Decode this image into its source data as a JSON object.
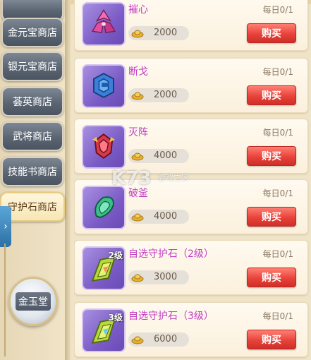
{
  "sidebar": {
    "tabs": [
      {
        "label": "金元宝商店"
      },
      {
        "label": "银元宝商店"
      },
      {
        "label": "荟英商店"
      },
      {
        "label": "武将商店"
      },
      {
        "label": "技能书商店"
      },
      {
        "label": "守护石商店"
      }
    ],
    "expand_icon": "›",
    "gold_hall_label": "金玉堂"
  },
  "items": [
    {
      "name": "摧心",
      "daily": "每日0/1",
      "price": "2000",
      "buy": "购买",
      "color": "#e04fa0"
    },
    {
      "name": "断戈",
      "daily": "每日0/1",
      "price": "2000",
      "buy": "购买",
      "color": "#3a7fd9"
    },
    {
      "name": "灭阵",
      "daily": "每日0/1",
      "price": "4000",
      "buy": "购买",
      "color": "#d93a4a"
    },
    {
      "name": "破釜",
      "daily": "每日0/1",
      "price": "4000",
      "buy": "购买",
      "color": "#3abf8a"
    },
    {
      "name": "自选守护石（2级）",
      "daily": "每日0/1",
      "price": "3000",
      "buy": "购买",
      "badge": "2级",
      "color": "#b9d93a"
    },
    {
      "name": "自选守护石（3级）",
      "daily": "每日0/1",
      "price": "6000",
      "buy": "购买",
      "badge": "3级",
      "color": "#b9d93a"
    }
  ],
  "watermark": {
    "text": "K73",
    "sub": "游戏之家"
  }
}
